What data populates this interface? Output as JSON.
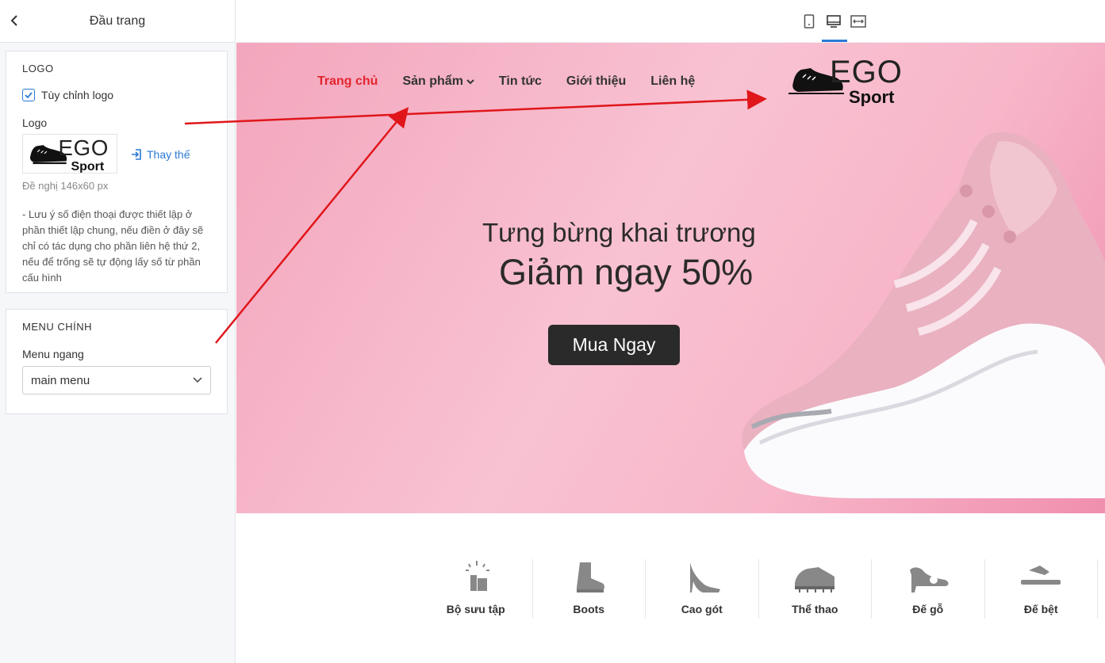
{
  "panel": {
    "title": "Đầu trang",
    "logo_section": {
      "heading": "LOGO",
      "custom_logo_label": "Tùy chỉnh logo",
      "custom_logo_checked": true,
      "logo_label": "Logo",
      "replace_label": "Thay thế",
      "size_hint": "Đề nghị 146x60 px",
      "note": "- Lưu ý số điện thoại được thiết lập ở phần thiết lập chung, nếu điền ở đây sẽ chỉ có tác dụng cho phần liên hệ thứ 2, nếu để trống sẽ tự động lấy số từ phần cấu hình"
    },
    "menu_section": {
      "heading": "MENU CHÍNH",
      "field_label": "Menu ngang",
      "selected": "main menu"
    }
  },
  "device_toolbar": {
    "icons": [
      "mobile-icon",
      "desktop-icon",
      "fullwidth-icon"
    ],
    "active": "desktop-icon",
    "accent": "#2a7ad6"
  },
  "preview": {
    "nav": [
      "Trang chủ",
      "Sản phẩm",
      "Tin tức",
      "Giới thiệu",
      "Liên hệ"
    ],
    "active_nav": "Trang chủ",
    "logo_text": {
      "top": "EGO",
      "bottom": "Sport"
    },
    "hero": {
      "line1": "Tưng bừng khai trương",
      "line2": "Giảm ngay 50%",
      "button": "Mua Ngay"
    },
    "categories": [
      "Bộ sưu tập",
      "Boots",
      "Cao gót",
      "Thể thao",
      "Đế gỗ",
      "Đế bệt"
    ]
  },
  "colors": {
    "active_nav": "#e3252e",
    "arrow": "#e0161b",
    "hero_bg": "#f6b8ca",
    "button_bg": "#2a2a2a"
  }
}
